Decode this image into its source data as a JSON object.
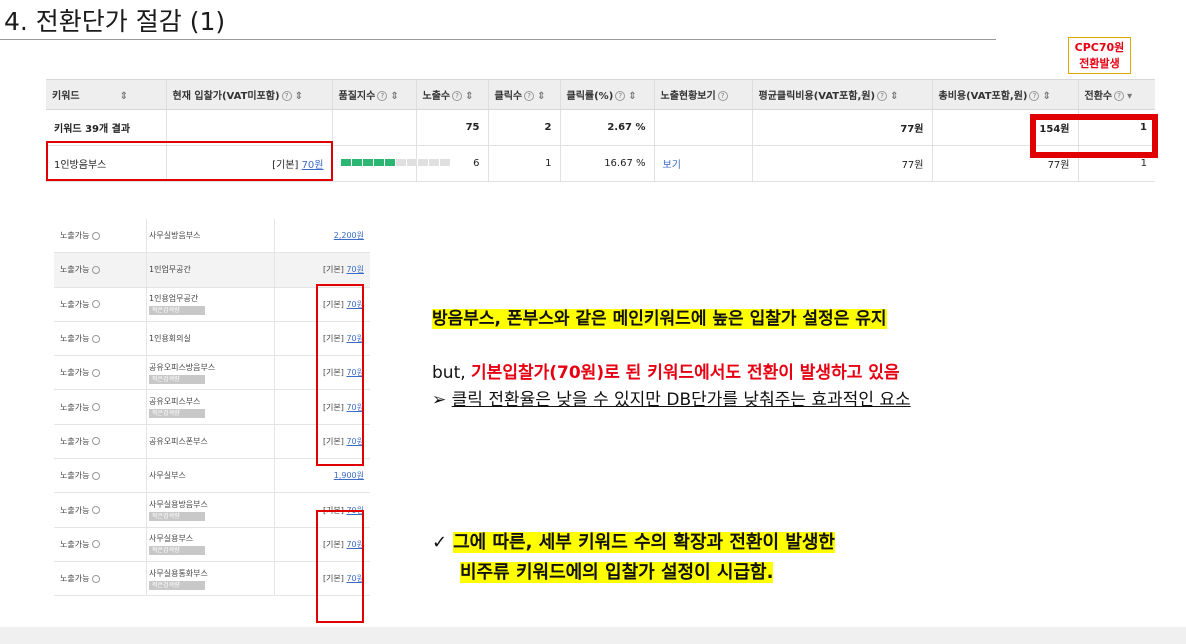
{
  "title": "4. 전환단가 절감 (1)",
  "cpc_badge": {
    "line1": "CPC70원",
    "line2": "전환발생"
  },
  "table": {
    "headers": [
      {
        "label": "키워드",
        "help": false
      },
      {
        "label": "현재 입찰가(VAT미포함)",
        "help": true
      },
      {
        "label": "품질지수",
        "help": true
      },
      {
        "label": "노출수",
        "help": true
      },
      {
        "label": "클릭수",
        "help": true
      },
      {
        "label": "클릭률(%)",
        "help": true
      },
      {
        "label": "노출현황보기",
        "help": true
      },
      {
        "label": "평균클릭비용(VAT포함,원)",
        "help": true
      },
      {
        "label": "총비용(VAT포함,원)",
        "help": true
      },
      {
        "label": "전환수",
        "help": true
      }
    ],
    "summary": {
      "keyword": "키워드 39개 결과",
      "bid": "",
      "quality": "",
      "impressions": "75",
      "clicks": "2",
      "ctr": "2.67 %",
      "view": "",
      "avg_cpc": "77원",
      "total_cost": "154원",
      "conversions": "1"
    },
    "row": {
      "keyword": "1인방음부스",
      "bid_prefix": "[기본]",
      "bid_value": "70원",
      "quality_level": 5,
      "quality_max": 10,
      "impressions": "6",
      "clicks": "1",
      "ctr": "16.67 %",
      "view": "보기",
      "avg_cpc": "77원",
      "total_cost": "77원",
      "conversions": "1"
    }
  },
  "keyword_list": [
    {
      "status": "노출가능",
      "name": "사무실방음부스",
      "tag": "",
      "price_prefix": "",
      "price": "2,200원",
      "shade": false
    },
    {
      "status": "노출가능",
      "name": "1인업무공간",
      "tag": "",
      "price_prefix": "[기본]",
      "price": "70원",
      "shade": true
    },
    {
      "status": "노출가능",
      "name": "1인용업무공간",
      "tag": "적은검색량",
      "price_prefix": "[기본]",
      "price": "70원",
      "shade": false
    },
    {
      "status": "노출가능",
      "name": "1인용회의실",
      "tag": "",
      "price_prefix": "[기본]",
      "price": "70원",
      "shade": false
    },
    {
      "status": "노출가능",
      "name": "공유오피스방음부스",
      "tag": "적은검색량",
      "price_prefix": "[기본]",
      "price": "70원",
      "shade": false
    },
    {
      "status": "노출가능",
      "name": "공유오피스부스",
      "tag": "적은검색량",
      "price_prefix": "[기본]",
      "price": "70원",
      "shade": false
    },
    {
      "status": "노출가능",
      "name": "공유오피스폰부스",
      "tag": "",
      "price_prefix": "[기본]",
      "price": "70원",
      "shade": false
    },
    {
      "status": "노출가능",
      "name": "사무실부스",
      "tag": "",
      "price_prefix": "",
      "price": "1,900원",
      "shade": false
    },
    {
      "status": "노출가능",
      "name": "사무실용방음부스",
      "tag": "적은검색량",
      "price_prefix": "[기본]",
      "price": "70원",
      "shade": false
    },
    {
      "status": "노출가능",
      "name": "사무실용부스",
      "tag": "적은검색량",
      "price_prefix": "[기본]",
      "price": "70원",
      "shade": false
    },
    {
      "status": "노출가능",
      "name": "사무실용통화부스",
      "tag": "적은검색량",
      "price_prefix": "[기본]",
      "price": "70원",
      "shade": false
    }
  ],
  "notes": {
    "line1": "방음부스, 폰부스와 같은 메인키워드에 높은 입찰가 설정은 유지",
    "line2_prefix": "but, ",
    "line2_red": "기본입찰가(70원)로 된 키워드에서도 전환이 발생하고 있음",
    "line3_bullet": "➢",
    "line3": "클릭 전환율은 낮을 수 있지만 DB단가를 낮춰주는 효과적인 요소",
    "check": "✓",
    "line4a": "그에 따른, 세부 키워드 수의 확장과 전환이 발생한",
    "line4b": "비주류 키워드에의 입찰가 설정이 시급함."
  },
  "colors": {
    "highlight": "#ffff00",
    "red": "#e60012",
    "box": "#e00000"
  }
}
